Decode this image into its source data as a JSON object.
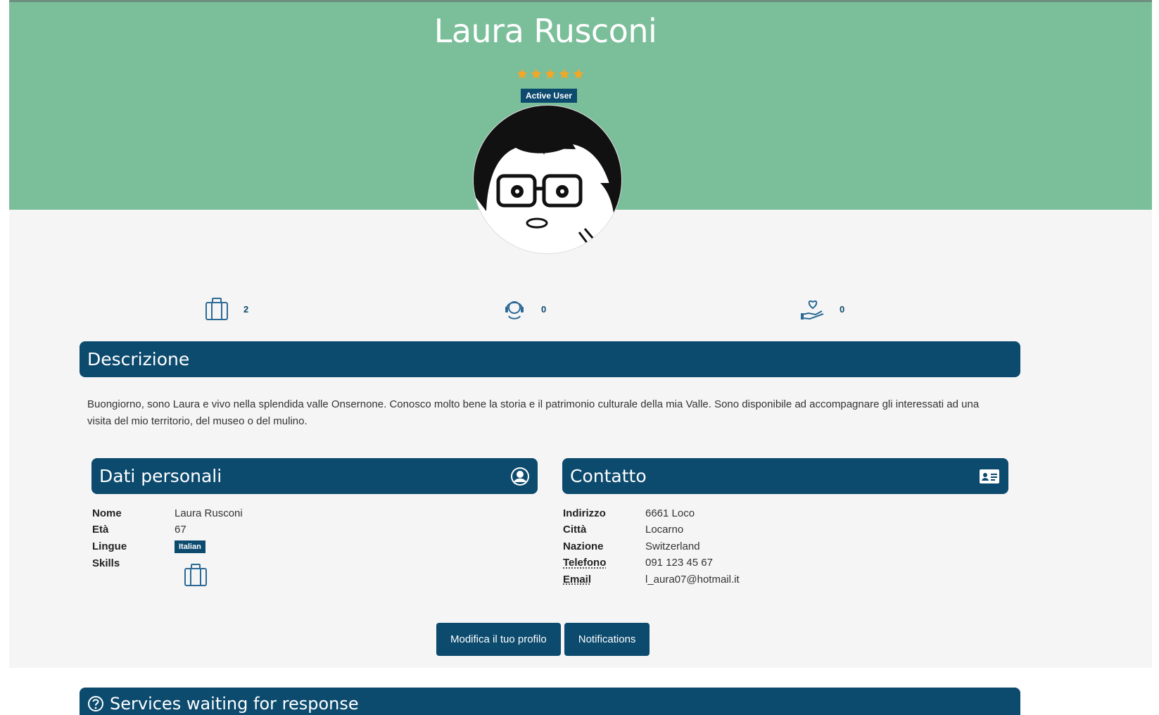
{
  "profile": {
    "name": "Laura Rusconi",
    "rating": 5,
    "rating_max": 5,
    "status_badge": "Active User",
    "star_color": "#f5a623"
  },
  "stats": [
    {
      "icon": "briefcase-icon",
      "value": "2"
    },
    {
      "icon": "support-agent-icon",
      "value": "0"
    },
    {
      "icon": "heart-hand-icon",
      "value": "0"
    }
  ],
  "description": {
    "title": "Descrizione",
    "text": "Buongiorno, sono Laura e vivo nella splendida valle Onsernone. Conosco molto bene la storia e il patrimonio culturale della mia Valle. Sono disponibile ad accompagnare gli interessati ad una visita del mio territorio, del museo o del mulino."
  },
  "personal": {
    "title": "Dati personali",
    "icon": "user-circle-icon",
    "fields": {
      "name_label": "Nome",
      "name_value": "Laura Rusconi",
      "age_label": "Età",
      "age_value": "67",
      "languages_label": "Lingue",
      "languages": [
        "Italian"
      ],
      "skills_label": "Skills",
      "skills_icon": "briefcase-icon"
    }
  },
  "contact": {
    "title": "Contatto",
    "icon": "id-card-icon",
    "fields": {
      "address_label": "Indirizzo",
      "address_value": "6661 Loco",
      "city_label": "Città",
      "city_value": "Locarno",
      "country_label": "Nazione",
      "country_value": "Switzerland",
      "phone_label": "Telefono",
      "phone_value": "091 123 45 67",
      "email_label": "Email",
      "email_value": "l_aura07@hotmail.it"
    }
  },
  "actions": {
    "edit_profile": "Modifica il tuo profilo",
    "notifications": "Notifications"
  },
  "services": {
    "title": "Services waiting for response",
    "icon": "question-circle-icon"
  },
  "colors": {
    "hero": "#7bbe9a",
    "primary": "#0c4a6e",
    "page_bg": "#f5f5f5",
    "link": "#337ab7"
  }
}
